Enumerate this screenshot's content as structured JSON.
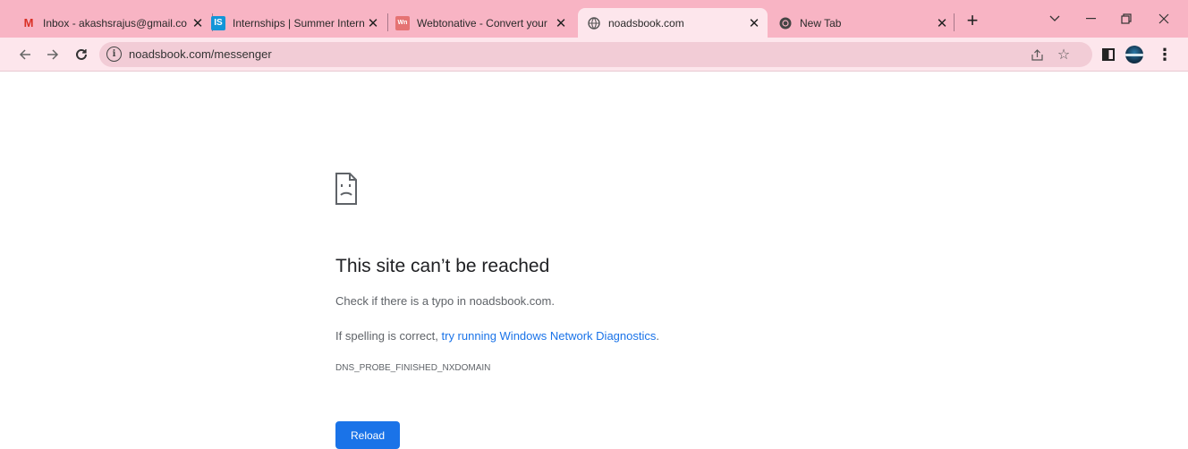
{
  "tabs": [
    {
      "title": "Inbox - akashsrajus@gmail.co",
      "icon": "gmail-icon",
      "active": false
    },
    {
      "title": "Internships | Summer Interns",
      "icon": "internshala-icon",
      "active": false
    },
    {
      "title": "Webtonative - Convert your",
      "icon": "webtonative-icon",
      "active": false
    },
    {
      "title": "noadsbook.com",
      "icon": "globe-icon",
      "active": true
    },
    {
      "title": "New Tab",
      "icon": "chrome-icon",
      "active": false
    }
  ],
  "tab_icons": {
    "gmail": "M",
    "internshala": "IS",
    "webtonative": "Wn"
  },
  "toolbar": {
    "url": "noadsbook.com/messenger"
  },
  "error": {
    "title": "This site can’t be reached",
    "line1": "Check if there is a typo in noadsbook.com.",
    "line2_prefix": "If spelling is correct, ",
    "line2_link": "try running Windows Network Diagnostics",
    "line2_suffix": ".",
    "code": "DNS_PROBE_FINISHED_NXDOMAIN",
    "reload_label": "Reload"
  },
  "colors": {
    "tabstrip": "#f8b4c4",
    "active_tab": "#fde6ec",
    "link": "#1a73e8",
    "button": "#1a73e8"
  }
}
